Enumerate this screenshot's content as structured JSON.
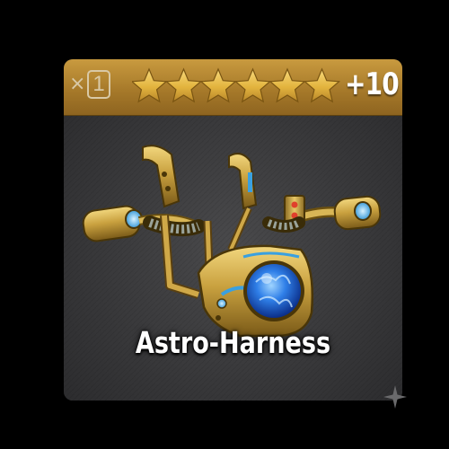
{
  "item": {
    "name": "Astro-Harness",
    "count_prefix": "×",
    "count": "1",
    "stars": 6,
    "level": "+10"
  },
  "icons": {
    "star": "star-icon",
    "sparkle": "sparkle-icon"
  },
  "colors": {
    "header_gold": "#b5862f",
    "star_gold": "#e3b43e",
    "card_bg": "#3c3c3e",
    "orb_blue": "#2f7fe8"
  }
}
